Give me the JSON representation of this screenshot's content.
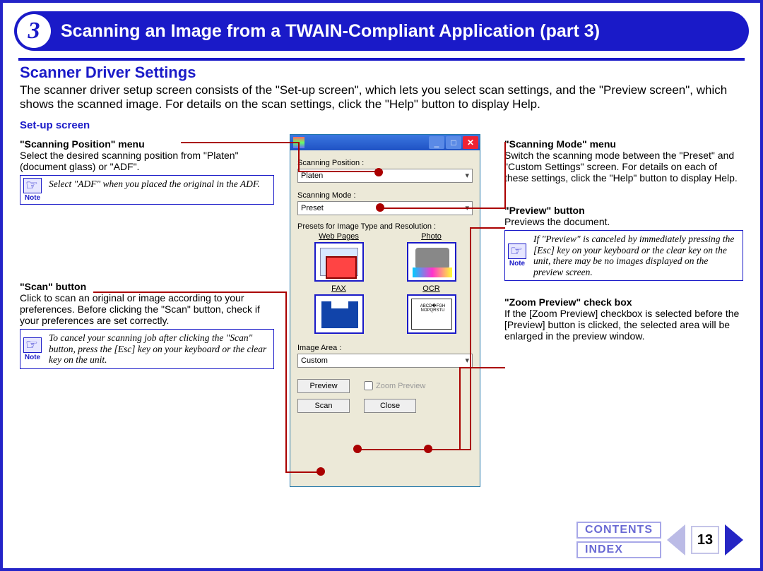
{
  "chapter": {
    "number": "3",
    "title": "Scanning an Image from a TWAIN-Compliant Application (part 3)"
  },
  "section": {
    "title": "Scanner Driver Settings",
    "body": "The scanner driver setup screen consists of the \"Set-up screen\", which lets you select scan settings, and the \"Preview screen\", which shows the scanned image. For details on the scan settings, click the \"Help\" button to display Help."
  },
  "subsection": "Set-up screen",
  "left": {
    "scanpos": {
      "title": "\"Scanning Position\" menu",
      "body": "Select the desired scanning position from \"Platen\" (document glass) or \"ADF\".",
      "note": "Select \"ADF\" when you placed the original in the ADF."
    },
    "scan": {
      "title": "\"Scan\" button",
      "body": "Click to scan an original or image according to your preferences. Before clicking the \"Scan\" button, check if your preferences are set correctly.",
      "note": "To cancel your scanning job after clicking the \"Scan\" button, press the [Esc] key on your keyboard or the clear key on the unit."
    }
  },
  "right": {
    "scanmode": {
      "title": "\"Scanning Mode\" menu",
      "body": "Switch the scanning mode between the \"Preset\" and \"Custom Settings\" screen. For details on each of these settings, click the \"Help\" button to display Help."
    },
    "preview": {
      "title": "\"Preview\" button",
      "body": "Previews the document.",
      "note": "If \"Preview\" is canceled by immediately pressing the [Esc] key on your keyboard or the clear key on the unit, there may be no images displayed on the preview screen."
    },
    "zoom": {
      "title": "\"Zoom Preview\" check box",
      "body": "If the [Zoom Preview] checkbox is selected before the [Preview] button is clicked, the selected area will be enlarged in the preview window."
    }
  },
  "note_label": "Note",
  "win": {
    "scanpos_label": "Scanning Position :",
    "scanpos_value": "Platen",
    "scanmode_label": "Scanning Mode :",
    "scanmode_value": "Preset",
    "presets_label": "Presets for Image Type and Resolution :",
    "web": "Web Pages",
    "photo": "Photo",
    "fax": "FAX",
    "ocr": "OCR",
    "imagearea_label": "Image Area :",
    "imagearea_value": "Custom",
    "zoom_preview": "Zoom Preview",
    "preview_btn": "Preview",
    "scan_btn": "Scan",
    "close_btn": "Close"
  },
  "footer": {
    "contents": "CONTENTS",
    "index": "INDEX",
    "page": "13"
  }
}
